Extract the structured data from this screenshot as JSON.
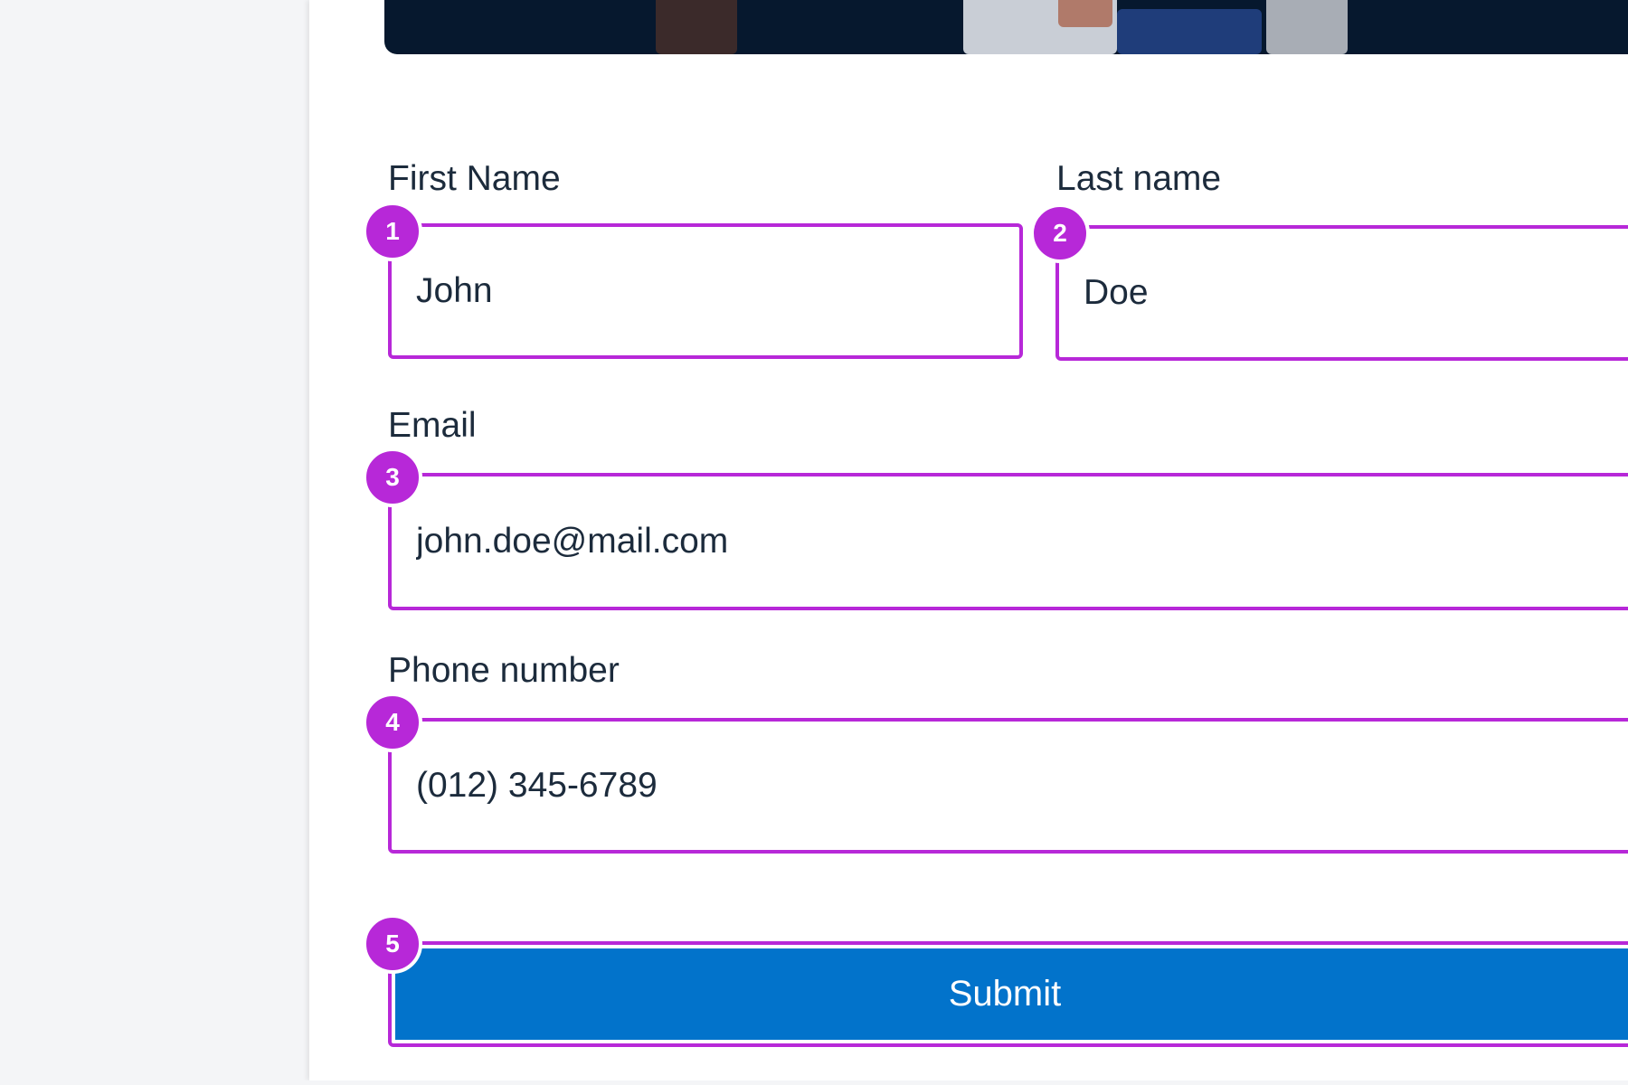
{
  "form": {
    "fields": [
      {
        "number": "1",
        "label": "First Name",
        "value": "John"
      },
      {
        "number": "2",
        "label": "Last name",
        "value": "Doe"
      },
      {
        "number": "3",
        "label": "Email",
        "value": "john.doe@mail.com"
      },
      {
        "number": "4",
        "label": "Phone number",
        "value": "(012) 345-6789"
      }
    ],
    "submit": {
      "number": "5",
      "label": "Submit"
    }
  },
  "colors": {
    "annotation": "#b728d8",
    "button": "#0273cb",
    "text": "#1c2b3c",
    "sidebar_bg": "#f4f5f7",
    "hero_bg": "#06182e"
  }
}
